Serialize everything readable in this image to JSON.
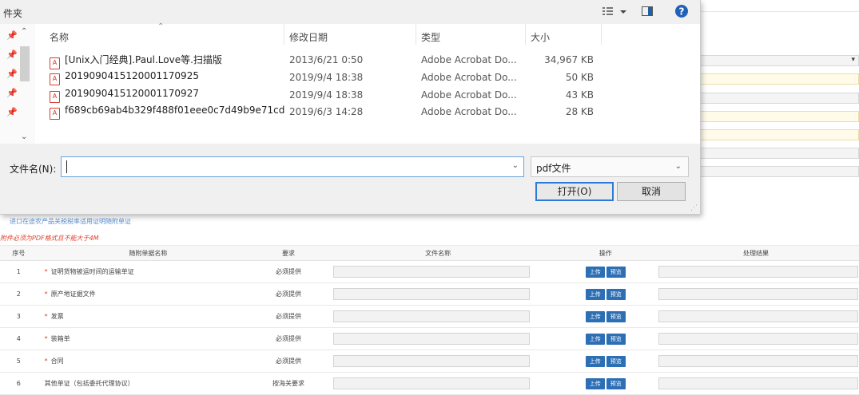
{
  "dialog": {
    "title": "件夹",
    "view_icon": "view-options-icon",
    "columns": {
      "name": "名称",
      "modified": "修改日期",
      "type": "类型",
      "size": "大小"
    },
    "files": [
      {
        "name": "[Unix入门经典].Paul.Love等.扫描版",
        "modified": "2013/6/21 0:50",
        "type": "Adobe Acrobat Do...",
        "size": "34,967 KB"
      },
      {
        "name": "201909041512000 1170925",
        "modified": "2019/9/4 18:38",
        "type": "Adobe Acrobat Do...",
        "size": "50 KB"
      },
      {
        "name": "2019090415120001170927",
        "modified": "2019/9/4 18:38",
        "type": "Adobe Acrobat Do...",
        "size": "43 KB"
      },
      {
        "name": "f689cb69ab4b329f488f01eee0c7d49b9e71cd",
        "modified": "2019/6/3 14:28",
        "type": "Adobe Acrobat Do...",
        "size": "28 KB"
      }
    ],
    "filename_label": "文件名(N):",
    "filename_value": "",
    "filetype_value": "pdf文件",
    "open_label": "打开(O)",
    "cancel_label": "取消"
  },
  "page": {
    "link_text": "进口在途农产品关税税率适用证明随附单证",
    "warning_text": "附件必须为PDF格式且不能大于4M",
    "table": {
      "headers": {
        "idx": "序号",
        "name": "随附单据名称",
        "req": "要求",
        "file": "文件名称",
        "op": "操作",
        "result": "处理结果"
      },
      "upload_label": "上传",
      "preview_label": "预览",
      "rows": [
        {
          "idx": "1",
          "name": "证明货物被运时间的运输单证",
          "req": "必须提供"
        },
        {
          "idx": "2",
          "name": "原产地证据文件",
          "req": "必须提供"
        },
        {
          "idx": "3",
          "name": "发票",
          "req": "必须提供"
        },
        {
          "idx": "4",
          "name": "装箱单",
          "req": "必须提供"
        },
        {
          "idx": "5",
          "name": "合同",
          "req": "必须提供"
        },
        {
          "idx": "6",
          "name": "其他单证（包括委托代理协议）",
          "req": "按海关要求"
        }
      ]
    }
  },
  "colors": {
    "accent": "#2a7ad6",
    "button_blue": "#2d6fb5",
    "warning": "#e0402b"
  }
}
